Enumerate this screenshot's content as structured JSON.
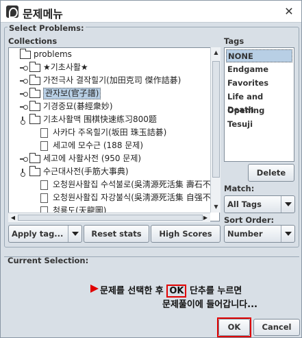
{
  "window": {
    "title": "문제메뉴",
    "close_glyph": "✕"
  },
  "select_problems_label": "Select Problems:",
  "collections": {
    "label": "Collections",
    "items": [
      {
        "label": "problems",
        "level": 0,
        "type": "folder",
        "handle": "none"
      },
      {
        "label": "★기초사활★",
        "level": 1,
        "type": "folder",
        "handle": "closed"
      },
      {
        "label": "가전극사 결작힐기(加田克司 傑作詰碁)",
        "level": 1,
        "type": "folder",
        "handle": "closed"
      },
      {
        "label": "관자보(官子譜)",
        "level": 1,
        "type": "folder",
        "handle": "closed",
        "selected": true
      },
      {
        "label": "기경중묘(碁經衆妙)",
        "level": 1,
        "type": "folder",
        "handle": "closed"
      },
      {
        "label": "기초사활맥 围棋快速练习800题",
        "level": 1,
        "type": "folder",
        "handle": "open"
      },
      {
        "label": "사카다 주옥힐기(坂田 珠玉詰碁)",
        "level": 2,
        "type": "file"
      },
      {
        "label": "세고에 모수근 (188 문제)",
        "level": 2,
        "type": "file"
      },
      {
        "label": "세고에 사활사전 (950 문제)",
        "level": 1,
        "type": "folder",
        "handle": "closed"
      },
      {
        "label": "수근대사전(手筋大事典)",
        "level": 1,
        "type": "folder",
        "handle": "open"
      },
      {
        "label": "오청원사활집 수석불로(吳淸源死活集 壽石不老)",
        "level": 2,
        "type": "file"
      },
      {
        "label": "오청원사활집 자강불식(吳淸源死活集 自强不息)",
        "level": 2,
        "type": "file"
      },
      {
        "label": "청룡도(天龍圖)",
        "level": 2,
        "type": "file"
      }
    ]
  },
  "tags": {
    "label": "Tags",
    "items": [
      "NONE",
      "Endgame",
      "Favorites",
      "Life and Death",
      "Opening",
      "Tesuji"
    ],
    "selected_index": 0
  },
  "buttons": {
    "delete": "Delete",
    "apply_tag": "Apply tag...",
    "reset_stats": "Reset stats",
    "high_scores": "High Scores",
    "ok": "OK",
    "cancel": "Cancel"
  },
  "match": {
    "label": "Match:",
    "value": "All Tags"
  },
  "sort_order": {
    "label": "Sort Order:",
    "value": "Number"
  },
  "current_selection_label": "Current Selection:",
  "annotation": {
    "line1_before": "문제를 선택한 후 ",
    "line1_ok": "OK",
    "line1_after": " 단추를 누르면",
    "line2": "문제풀이에 들어갑니다..."
  },
  "colors": {
    "accent_red": "#e00000",
    "selection": "#b8cfe5"
  }
}
